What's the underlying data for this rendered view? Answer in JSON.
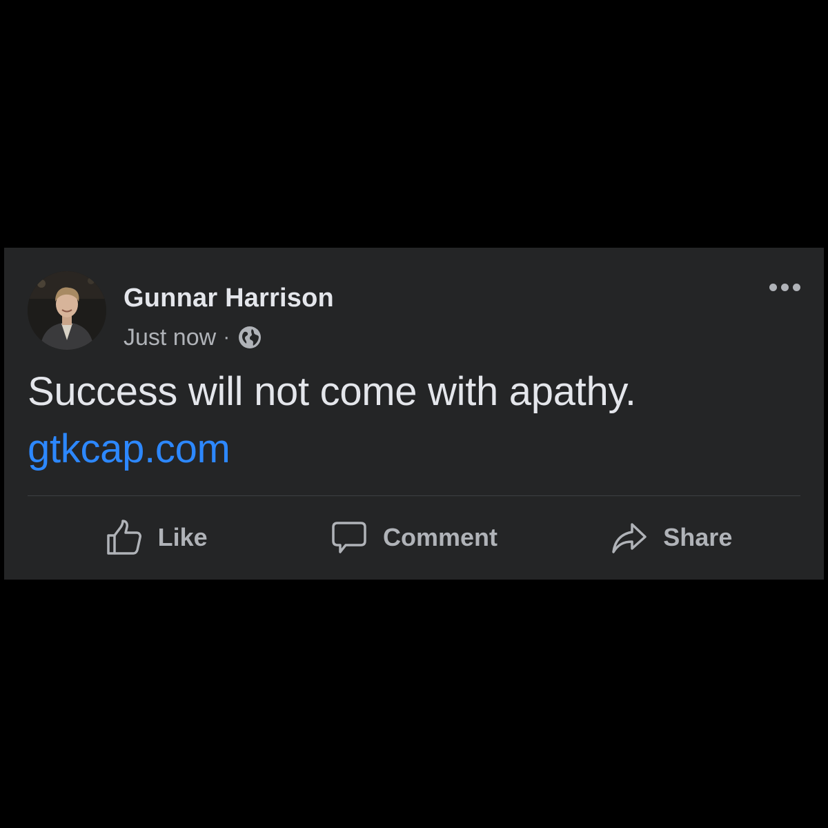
{
  "post": {
    "author": "Gunnar Harrison",
    "timestamp": "Just now",
    "separator": "·",
    "audience_icon": "globe-icon",
    "more_icon": "more-options-icon",
    "text": "Success will not come with apathy.",
    "link": "gtkcap.com"
  },
  "actions": {
    "like": {
      "label": "Like",
      "icon": "thumbs-up-icon"
    },
    "comment": {
      "label": "Comment",
      "icon": "speech-bubble-icon"
    },
    "share": {
      "label": "Share",
      "icon": "share-arrow-icon"
    }
  },
  "colors": {
    "background": "#000000",
    "card": "#242526",
    "primary_text": "#e4e6eb",
    "secondary_text": "#b0b3b8",
    "link": "#2d88ff",
    "divider": "#3e4042"
  }
}
